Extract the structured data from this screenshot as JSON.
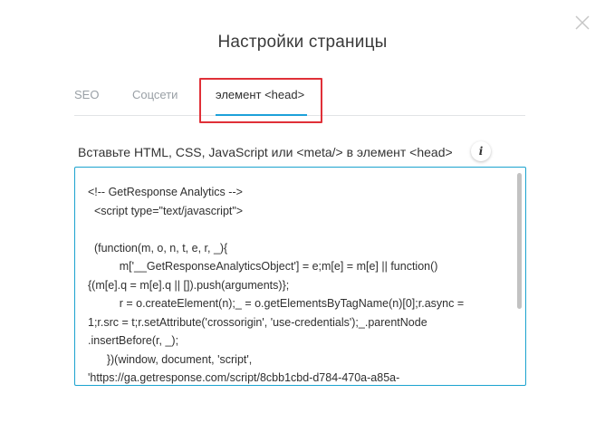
{
  "dialog": {
    "title": "Настройки страницы"
  },
  "tabs": [
    {
      "label": "SEO",
      "active": false
    },
    {
      "label": "Соцсети",
      "active": false
    },
    {
      "label": "элемент <head>",
      "active": true
    }
  ],
  "field": {
    "label": "Вставьте HTML, CSS, JavaScript или <meta/> в элемент <head>",
    "info_icon": "i"
  },
  "code_lines": [
    "<!-- GetResponse Analytics -->",
    "  <script type=\"text/javascript\">",
    "",
    "  (function(m, o, n, t, e, r, _){",
    "          m['__GetResponseAnalyticsObject'] = e;m[e] = m[e] || function()",
    "{(m[e].q = m[e].q || []).push(arguments)};",
    "          r = o.createElement(n);_ = o.getElementsByTagName(n)[0];r.async =",
    "1;r.src = t;r.setAttribute('crossorigin', 'use-credentials');_.parentNode",
    ".insertBefore(r, _);",
    "      })(window, document, 'script',",
    "'https://ga.getresponse.com/script/8cbb1cbd-d784-470a-a85a-"
  ],
  "colors": {
    "accent": "#1da1d9",
    "highlight": "#e03038",
    "text": "#2f2f2f",
    "muted": "#9aa0a6"
  },
  "icons": {
    "close": "close-icon",
    "info": "info-icon"
  }
}
